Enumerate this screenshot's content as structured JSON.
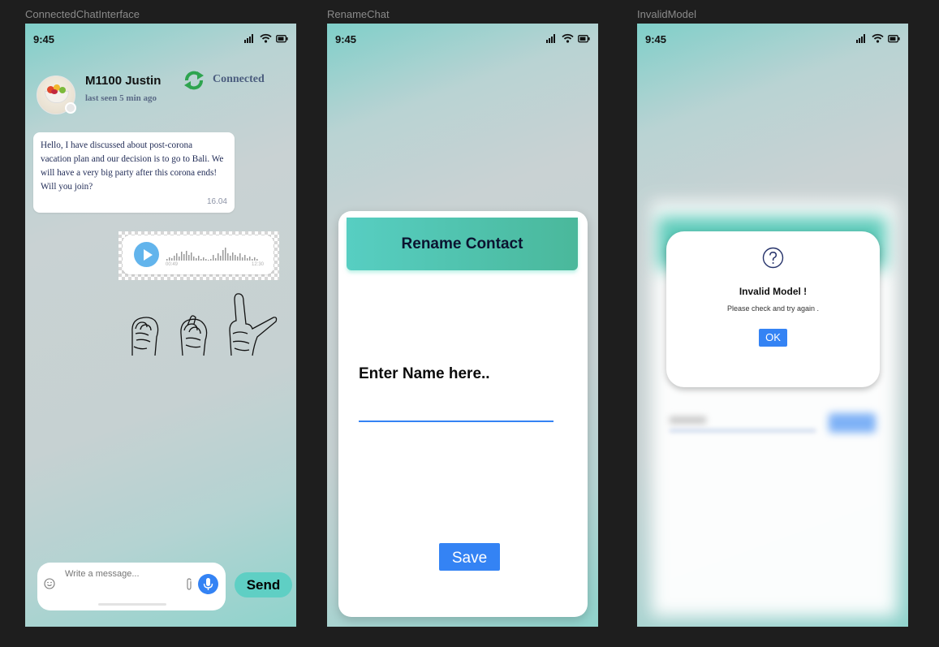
{
  "frames": {
    "chat": "ConnectedChatInterface",
    "rename": "RenameChat",
    "invalid": "InvalidModel"
  },
  "status_bar": {
    "time": "9:45"
  },
  "chat": {
    "contact_name": "M1100 Justin",
    "last_seen": "last seen 5 min ago",
    "status": "Connected",
    "message": {
      "text": "Hello, I have discussed about post-corona vacation plan and our decision is to go to Bali. We will have a very big party after this corona ends! Will you join?",
      "time": "16.04"
    },
    "voice_note": {
      "elapsed": "00:49",
      "duration": "12:30"
    },
    "composer": {
      "placeholder": "Write a message..."
    },
    "send_label": "Send"
  },
  "rename": {
    "title": "Rename Contact",
    "field_label": "Enter Name  here..",
    "save_label": "Save"
  },
  "invalid": {
    "title": "Invalid Model !",
    "message": "Please check and try again .",
    "ok_label": "OK"
  },
  "colors": {
    "primary_blue": "#3483f4",
    "teal": "#5fcfc4",
    "connected_green": "#2ea44f",
    "background": "#1e1e1e"
  },
  "icons": [
    "signal-icon",
    "wifi-icon",
    "battery-icon",
    "sync-icon",
    "play-icon",
    "smile-icon",
    "paperclip-icon",
    "mic-icon",
    "question-icon",
    "hand-sign-icon"
  ]
}
